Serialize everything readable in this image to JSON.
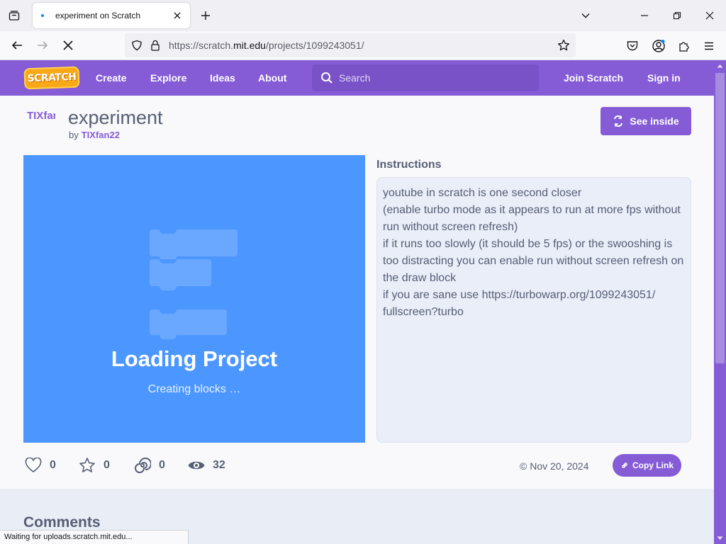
{
  "browser": {
    "tab_title": "experiment on Scratch",
    "url_prefix": "https://scratch.",
    "url_host": "mit.edu",
    "url_path": "/projects/1099243051/",
    "status_text": "Waiting for uploads.scratch.mit.edu..."
  },
  "nav": {
    "logo_text": "SCRATCH",
    "create": "Create",
    "explore": "Explore",
    "ideas": "Ideas",
    "about": "About",
    "search_placeholder": "Search",
    "join": "Join Scratch",
    "signin": "Sign in"
  },
  "project": {
    "author_avatar_text": "TIXfan",
    "title": "experiment",
    "by_label": "by",
    "author": "TIXfan22",
    "see_inside": "See inside",
    "loading_title": "Loading Project",
    "loading_subtitle": "Creating blocks …",
    "instructions_label": "Instructions",
    "instructions_lines": [
      "youtube in scratch is one second closer",
      "(enable turbo mode as it appears to run at more fps without",
      "run without screen refresh)",
      "if it runs too slowly (it should be 5 fps) or the swooshing is",
      "too distracting you can enable run without screen refresh on",
      "the draw block",
      "if you are sane use https://turbowarp.org/1099243051/",
      "fullscreen?turbo"
    ],
    "stats": {
      "loves": "0",
      "favorites": "0",
      "remixes": "0",
      "views": "32"
    },
    "share_date": "Nov 20, 2024",
    "copy_link": "Copy Link"
  },
  "comments": {
    "title": "Comments"
  },
  "colors": {
    "scratch_purple": "#855cd6",
    "stage_blue": "#4c97ff"
  }
}
